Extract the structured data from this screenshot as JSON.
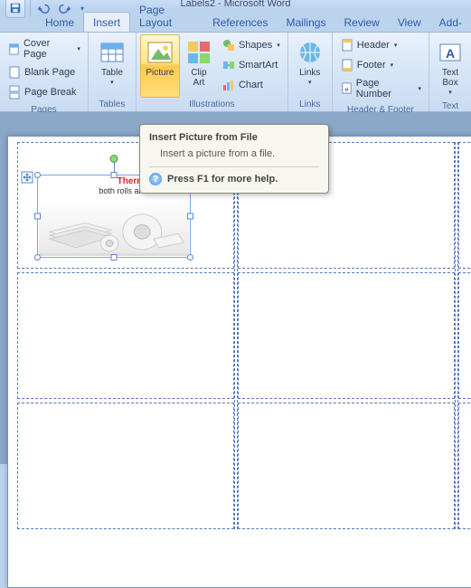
{
  "window": {
    "title": "Labels2 - Microsoft Word"
  },
  "qat": {
    "save": "save-icon",
    "undo": "undo-icon",
    "redo": "redo-icon"
  },
  "tabs": [
    "Home",
    "Insert",
    "Page Layout",
    "References",
    "Mailings",
    "Review",
    "View",
    "Add-"
  ],
  "active_tab": "Insert",
  "ribbon": {
    "groups": [
      {
        "name": "Pages",
        "label": "Pages",
        "items": [
          {
            "icon": "cover-page-icon",
            "label": "Cover Page",
            "drop": true
          },
          {
            "icon": "blank-page-icon",
            "label": "Blank Page",
            "drop": false
          },
          {
            "icon": "page-break-icon",
            "label": "Page Break",
            "drop": false
          }
        ]
      },
      {
        "name": "Tables",
        "label": "Tables",
        "big": {
          "icon": "table-icon",
          "label": "Table",
          "drop": true
        }
      },
      {
        "name": "Illustrations",
        "label": "Illustrations",
        "bigs": [
          {
            "icon": "picture-icon",
            "label": "Picture",
            "drop": false,
            "highlight": true
          },
          {
            "icon": "clipart-icon",
            "label": "Clip\nArt",
            "drop": false
          }
        ],
        "items": [
          {
            "icon": "shapes-icon",
            "label": "Shapes",
            "drop": true
          },
          {
            "icon": "smartart-icon",
            "label": "SmartArt",
            "drop": false
          },
          {
            "icon": "chart-icon",
            "label": "Chart",
            "drop": false
          }
        ]
      },
      {
        "name": "Links",
        "label": "Links",
        "big": {
          "icon": "links-icon",
          "label": "Links",
          "drop": true
        }
      },
      {
        "name": "HeaderFooter",
        "label": "Header & Footer",
        "items": [
          {
            "icon": "header-icon",
            "label": "Header",
            "drop": true
          },
          {
            "icon": "footer-icon",
            "label": "Footer",
            "drop": true
          },
          {
            "icon": "page-number-icon",
            "label": "Page Number",
            "drop": true
          }
        ]
      },
      {
        "name": "Text",
        "label": "Text",
        "big": {
          "icon": "textbox-icon",
          "label": "Text\nBox",
          "drop": true
        }
      }
    ]
  },
  "tooltip": {
    "title": "Insert Picture from File",
    "body": "Insert a picture from a file.",
    "help": "Press F1 for more help."
  },
  "document": {
    "image_text1": "Thermal Labels",
    "image_text2": "both rolls and fanfolded"
  }
}
